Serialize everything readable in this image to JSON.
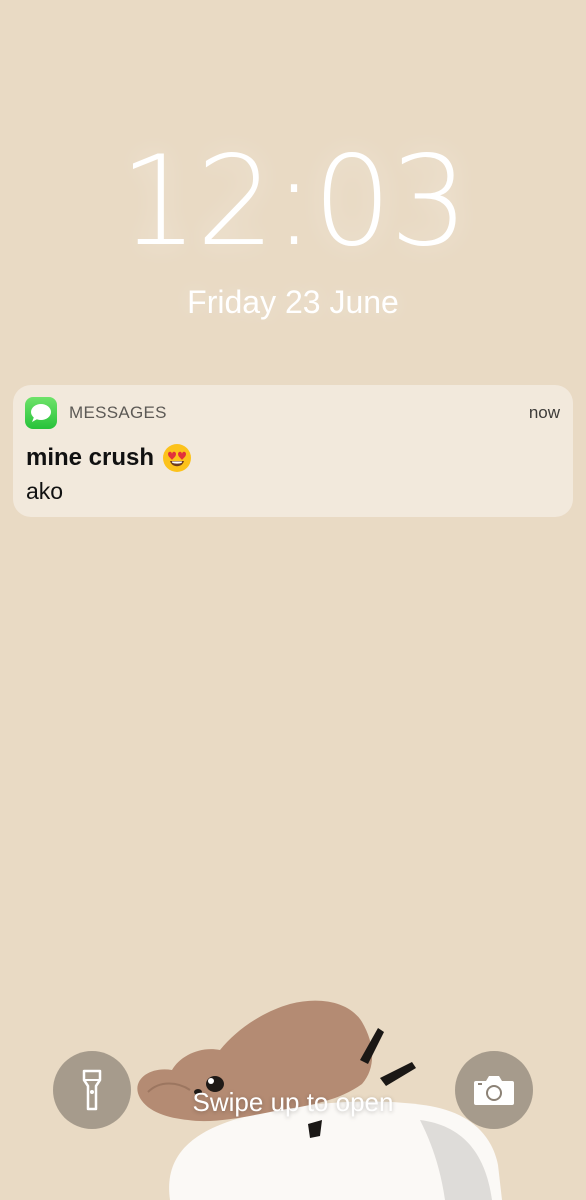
{
  "lock_screen": {
    "time": "12:03",
    "date": "Friday 23 June",
    "swipe_hint": "Swipe up to open"
  },
  "notification": {
    "app_name": "MESSAGES",
    "timestamp": "now",
    "sender": "mine crush",
    "sender_emoji": "smiling-face-with-heart-eyes",
    "message": "ako",
    "app_icon": "messages-icon"
  },
  "quick_actions": {
    "left_icon": "flashlight-icon",
    "right_icon": "camera-icon"
  },
  "colors": {
    "wallpaper": "#e9dac4",
    "notification_bg": "#f4ece2",
    "messages_green": "#34c84a",
    "button_bg": "#8c8276"
  }
}
